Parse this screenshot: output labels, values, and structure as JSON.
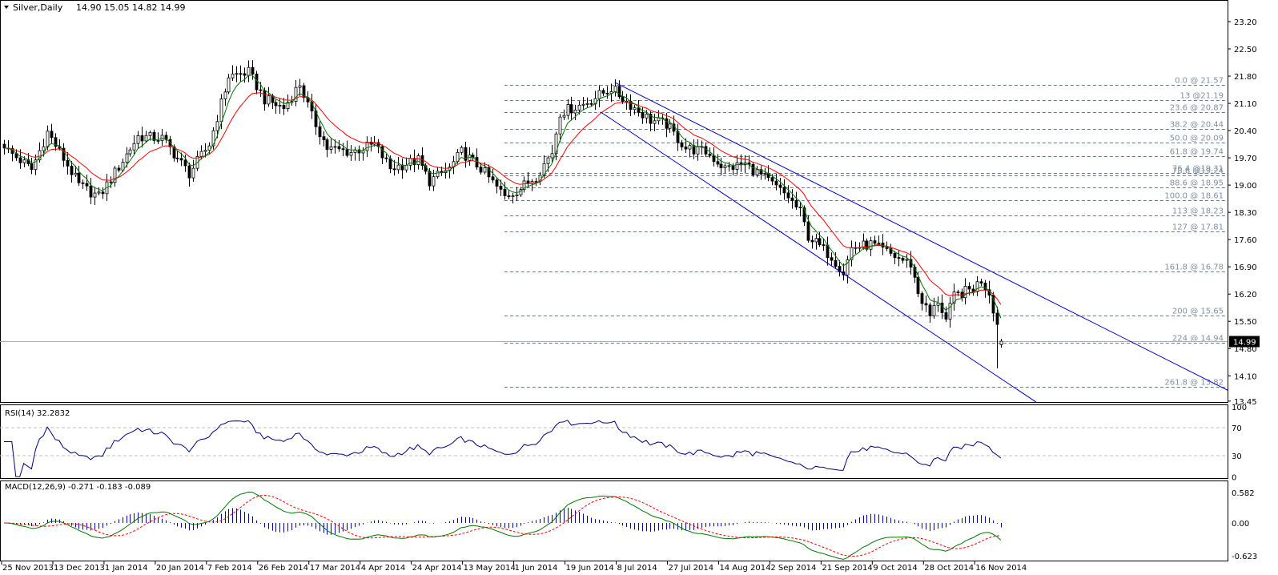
{
  "header": {
    "symbol": "Silver,Daily",
    "ohlc": "14.90 15.05 14.82 14.99"
  },
  "colors": {
    "bull": "#ffffff",
    "bear": "#000000",
    "fast_ma": "#007700",
    "slow_ma": "#ff0000",
    "channel": "#0000cc",
    "fib": "#6a7a8a",
    "rsi": "#000080",
    "macd_main": "#007700",
    "macd_signal": "#ff0000",
    "macd_hist": "#0000aa"
  },
  "chart_data": [
    {
      "type": "candlestick",
      "title": "Silver,Daily",
      "last_bar": {
        "open": 14.9,
        "high": 15.05,
        "low": 14.82,
        "close": 14.99
      },
      "current_price_label": "14.99",
      "ylim": [
        13.45,
        23.2
      ],
      "y_ticks": [
        "23.20",
        "22.50",
        "21.80",
        "21.10",
        "20.40",
        "19.70",
        "19.00",
        "18.30",
        "17.60",
        "16.90",
        "16.20",
        "15.50",
        "14.80",
        "14.10",
        "13.45"
      ],
      "x_tick_labels": [
        {
          "bar": 0,
          "label": "25 Nov 2013"
        },
        {
          "bar": 13,
          "label": "13 Dec 2013"
        },
        {
          "bar": 26,
          "label": "1 Jan 2014"
        },
        {
          "bar": 39,
          "label": "20 Jan 2014"
        },
        {
          "bar": 52,
          "label": "7 Feb 2014"
        },
        {
          "bar": 65,
          "label": "26 Feb 2014"
        },
        {
          "bar": 78,
          "label": "17 Mar 2014"
        },
        {
          "bar": 91,
          "label": "4 Apr 2014"
        },
        {
          "bar": 104,
          "label": "24 Apr 2014"
        },
        {
          "bar": 117,
          "label": "13 May 2014"
        },
        {
          "bar": 130,
          "label": "1 Jun 2014"
        },
        {
          "bar": 143,
          "label": "19 Jun 2014"
        },
        {
          "bar": 156,
          "label": "8 Jul 2014"
        },
        {
          "bar": 169,
          "label": "27 Jul 2014"
        },
        {
          "bar": 182,
          "label": "14 Aug 2014"
        },
        {
          "bar": 195,
          "label": "2 Sep 2014"
        },
        {
          "bar": 208,
          "label": "21 Sep 2014"
        },
        {
          "bar": 221,
          "label": "9 Oct 2014"
        },
        {
          "bar": 234,
          "label": "28 Oct 2014"
        },
        {
          "bar": 247,
          "label": "16 Nov 2014"
        }
      ],
      "close_keypoints": [
        [
          0,
          19.95
        ],
        [
          7,
          19.4
        ],
        [
          11,
          20.36
        ],
        [
          19,
          19.0
        ],
        [
          24,
          18.7
        ],
        [
          34,
          20.25
        ],
        [
          40,
          20.2
        ],
        [
          47,
          19.3
        ],
        [
          52,
          20.05
        ],
        [
          57,
          21.8
        ],
        [
          62,
          21.9
        ],
        [
          66,
          21.2
        ],
        [
          71,
          20.98
        ],
        [
          75,
          21.6
        ],
        [
          78,
          20.77
        ],
        [
          82,
          19.95
        ],
        [
          88,
          19.85
        ],
        [
          94,
          20.05
        ],
        [
          98,
          19.43
        ],
        [
          105,
          19.64
        ],
        [
          108,
          19.1
        ],
        [
          113,
          19.43
        ],
        [
          116,
          19.85
        ],
        [
          121,
          19.43
        ],
        [
          127,
          18.7
        ],
        [
          131,
          18.92
        ],
        [
          135,
          19.23
        ],
        [
          139,
          19.85
        ],
        [
          141,
          20.87
        ],
        [
          147,
          21.08
        ],
        [
          154,
          21.49
        ],
        [
          160,
          20.98
        ],
        [
          164,
          20.67
        ],
        [
          168,
          20.56
        ],
        [
          173,
          19.95
        ],
        [
          178,
          19.85
        ],
        [
          183,
          19.43
        ],
        [
          188,
          19.54
        ],
        [
          194,
          19.1
        ],
        [
          199,
          18.7
        ],
        [
          202,
          18.3
        ],
        [
          204,
          17.69
        ],
        [
          210,
          17.17
        ],
        [
          213,
          16.76
        ],
        [
          215,
          17.38
        ],
        [
          220,
          17.48
        ],
        [
          226,
          17.17
        ],
        [
          230,
          16.97
        ],
        [
          232,
          16.24
        ],
        [
          235,
          15.63
        ],
        [
          237,
          16.04
        ],
        [
          239,
          15.53
        ],
        [
          241,
          16.14
        ],
        [
          246,
          16.35
        ],
        [
          248,
          16.56
        ],
        [
          250,
          16.24
        ],
        [
          252,
          15.42
        ],
        [
          253,
          14.99
        ]
      ],
      "fibonacci": {
        "start_bar": 127,
        "levels": [
          {
            "price": 21.57,
            "label": "0.0 @ 21.57"
          },
          {
            "price": 21.19,
            "label": "13 @21.19"
          },
          {
            "price": 20.87,
            "label": "23.6 @ 20.87"
          },
          {
            "price": 20.44,
            "label": "38.2 @ 20.44"
          },
          {
            "price": 20.09,
            "label": "50.0 @ 20.09"
          },
          {
            "price": 19.74,
            "label": "61.8 @ 19.74"
          },
          {
            "price": 19.31,
            "label": "76.4 @19.31"
          },
          {
            "price": 19.24,
            "label": "78.6 @19.24"
          },
          {
            "price": 18.95,
            "label": "88.6 @ 18.95"
          },
          {
            "price": 18.61,
            "label": "100.0 @ 18.61"
          },
          {
            "price": 18.23,
            "label": "113 @ 18.23"
          },
          {
            "price": 17.81,
            "label": "127 @ 17.81"
          },
          {
            "price": 16.78,
            "label": "161.8 @ 16.78"
          },
          {
            "price": 15.65,
            "label": "200 @ 15.65"
          },
          {
            "price": 14.94,
            "label": "224 @ 14.94"
          },
          {
            "price": 13.82,
            "label": "261.8 @ 13.82"
          }
        ]
      },
      "channel": {
        "upper": [
          [
            155,
            21.64
          ],
          [
            310.6,
            13.73
          ]
        ],
        "lower": [
          [
            151.4,
            20.88
          ],
          [
            262.2,
            13.41
          ]
        ]
      },
      "moving_averages": [
        {
          "name": "fast",
          "period": 5
        },
        {
          "name": "slow",
          "period": 13
        }
      ]
    },
    {
      "type": "line",
      "title": "RSI(14) 32.2832",
      "ylim": [
        0,
        100
      ],
      "y_ticks": [
        "100",
        "70",
        "30",
        "0"
      ],
      "levels": [
        70,
        30
      ]
    },
    {
      "type": "bar+line",
      "title": "MACD(12,26,9) -0.271 -0.183 -0.089",
      "ylim": [
        -0.623,
        0.582
      ],
      "y_ticks": [
        "0.582",
        "0.00",
        "-0.623"
      ]
    }
  ]
}
